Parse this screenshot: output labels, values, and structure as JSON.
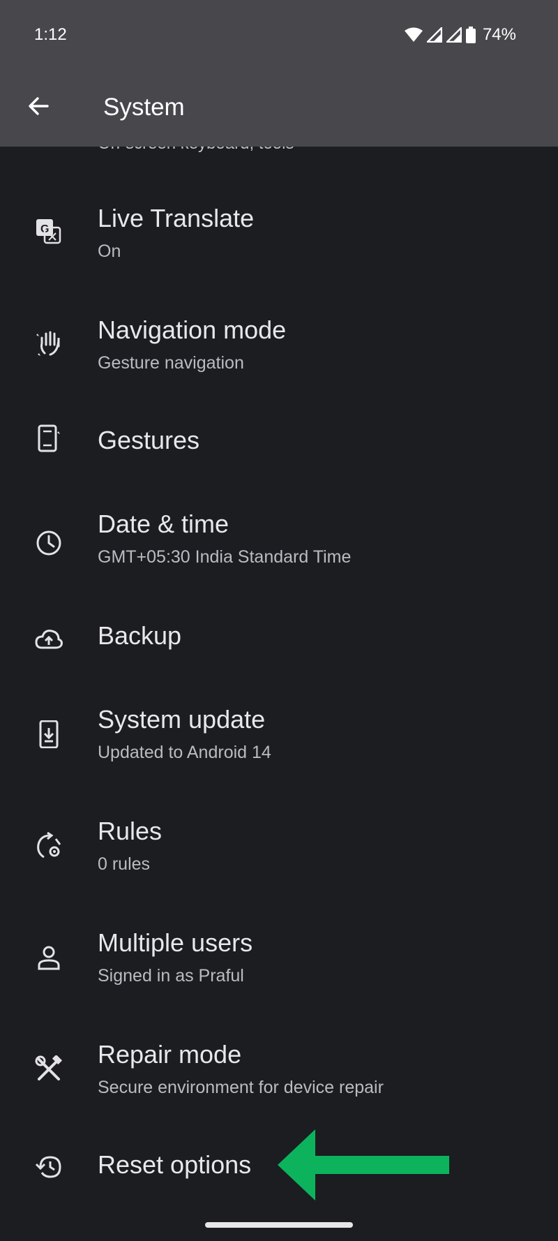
{
  "status_bar": {
    "time": "1:12",
    "battery": "74%"
  },
  "app_bar": {
    "title": "System"
  },
  "clipped_item": {
    "sub": "On-screen keyboard, tools"
  },
  "items": [
    {
      "label": "Live Translate",
      "sub": "On",
      "icon": "translate-icon"
    },
    {
      "label": "Navigation mode",
      "sub": "Gesture navigation",
      "icon": "gesture-hand-icon"
    },
    {
      "label": "Gestures",
      "sub": "",
      "icon": "phone-gesture-icon"
    },
    {
      "label": "Date & time",
      "sub": "GMT+05:30 India Standard Time",
      "icon": "clock-icon"
    },
    {
      "label": "Backup",
      "sub": "",
      "icon": "cloud-upload-icon"
    },
    {
      "label": "System update",
      "sub": "Updated to Android 14",
      "icon": "system-update-icon"
    },
    {
      "label": "Rules",
      "sub": "0 rules",
      "icon": "rules-icon"
    },
    {
      "label": "Multiple users",
      "sub": "Signed in as Praful",
      "icon": "person-icon"
    },
    {
      "label": "Repair mode",
      "sub": "Secure environment for device repair",
      "icon": "repair-tools-icon"
    },
    {
      "label": "Reset options",
      "sub": "",
      "icon": "history-icon"
    }
  ],
  "colors": {
    "background": "#1b1d21",
    "app_bar": "#48484c",
    "annotation_arrow": "#0cb35c"
  }
}
